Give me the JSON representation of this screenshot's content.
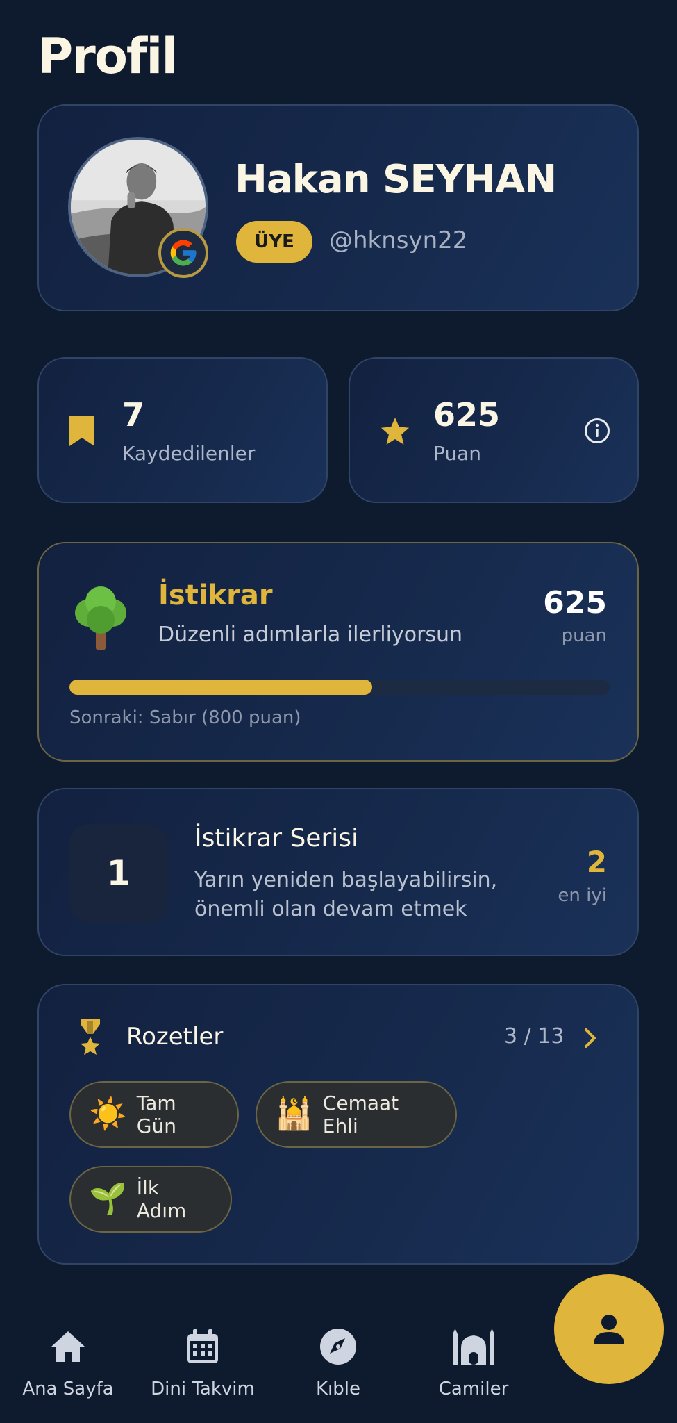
{
  "page": {
    "title": "Profil"
  },
  "profile": {
    "name": "Hakan SEYHAN",
    "badge": "ÜYE",
    "username": "@hknsyn22"
  },
  "stats": {
    "saved": {
      "value": "7",
      "label": "Kaydedilenler",
      "icon": "bookmark-icon"
    },
    "points": {
      "value": "625",
      "label": "Puan",
      "icon": "star-icon"
    }
  },
  "level": {
    "name": "İstikrar",
    "description": "Düzenli adımlarla ilerliyorsun",
    "points": "625",
    "points_unit": "puan",
    "progress_percent": 56,
    "next": "Sonraki: Sabır (800 puan)"
  },
  "streak": {
    "current": "1",
    "title": "İstikrar Serisi",
    "message": "Yarın yeniden başlayabilirsin, önemli olan devam etmek",
    "best": "2",
    "best_label": "en iyi"
  },
  "badges": {
    "title": "Rozetler",
    "count": "3 / 13",
    "items": [
      {
        "emoji": "☀️",
        "label": "Tam Gün"
      },
      {
        "emoji": "🕌",
        "label": "Cemaat Ehli"
      },
      {
        "emoji": "🌱",
        "label": "İlk Adım"
      }
    ]
  },
  "nav": {
    "items": [
      {
        "label": "Ana Sayfa",
        "icon": "home-icon"
      },
      {
        "label": "Dini Takvim",
        "icon": "calendar-icon"
      },
      {
        "label": "Kıble",
        "icon": "compass-icon"
      },
      {
        "label": "Camiler",
        "icon": "mosque-icon"
      }
    ],
    "active": "profile-icon"
  },
  "colors": {
    "background": "#0e1a2e",
    "accent": "#e0b53c",
    "card": "#162a4d"
  }
}
